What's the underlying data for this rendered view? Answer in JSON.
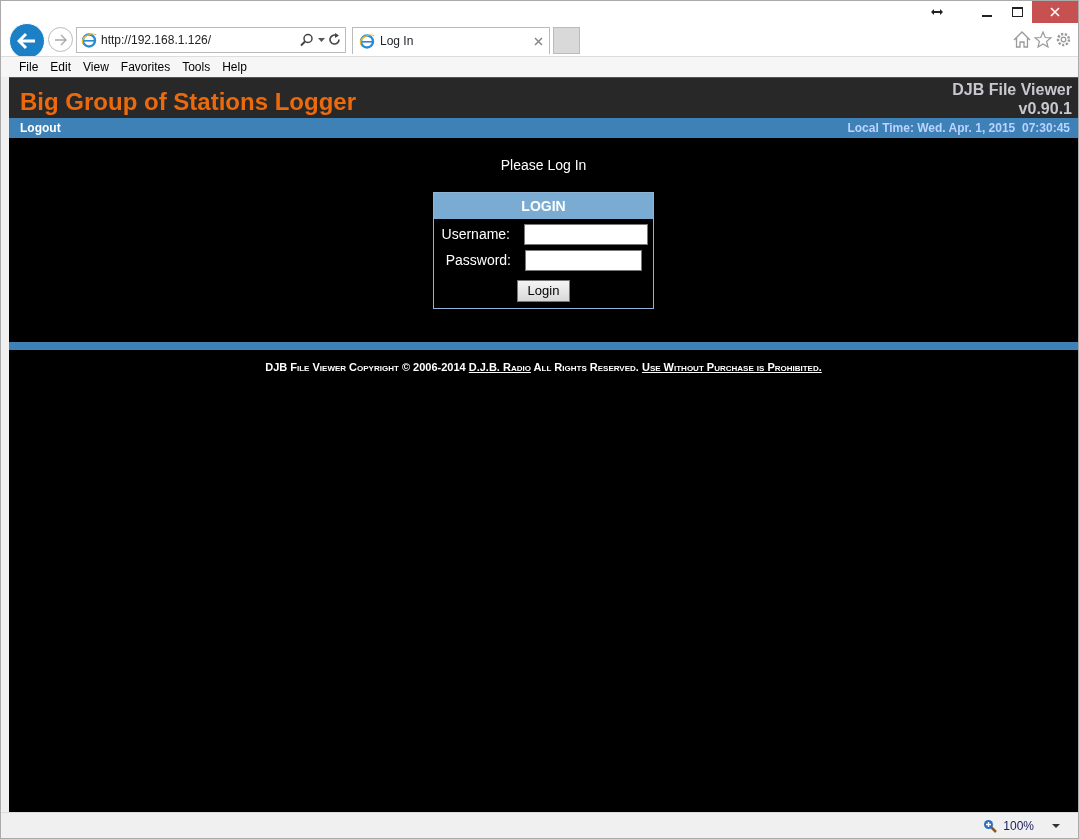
{
  "browser": {
    "address": "http://192.168.1.126/",
    "tab": {
      "title": "Log In",
      "selected": true
    },
    "menu": [
      "File",
      "Edit",
      "View",
      "Favorites",
      "Tools",
      "Help"
    ],
    "zoom": "100%"
  },
  "header": {
    "title": "Big Group of Stations Logger",
    "product": "DJB File Viewer",
    "version": "v0.90.1"
  },
  "navbar": {
    "logout": "Logout",
    "local_time": "Local Time: Wed. Apr. 1, 2015  07:30:45"
  },
  "prompt": "Please Log In",
  "login": {
    "title": "LOGIN",
    "fields": [
      {
        "label": "Username:"
      },
      {
        "label": "Password:"
      }
    ],
    "button": "Login"
  },
  "footer": {
    "text_before": "DJB File Viewer Copyright © 2006-2014",
    "company_link": "D.J.B. Radio",
    "text_middle": "All Rights Reserved.",
    "terms_link": "Use Without Purchase is Prohibited."
  }
}
